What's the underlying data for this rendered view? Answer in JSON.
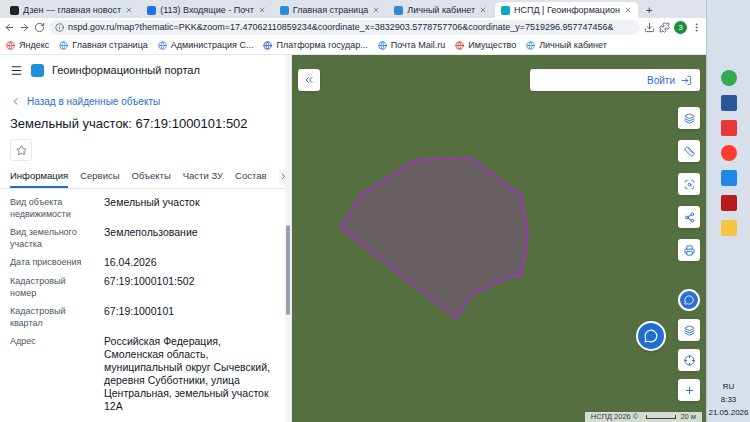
{
  "browser": {
    "tabs": [
      {
        "label": "Дзен — главная новост",
        "selected": false,
        "color": "#222222"
      },
      {
        "label": "(113) Входящие - Почт",
        "selected": false,
        "color": "#1a73e8"
      },
      {
        "label": "Главная страница",
        "selected": false,
        "color": "#2e8bd8"
      },
      {
        "label": "Личный кабинет",
        "selected": false,
        "color": "#2e8bd8"
      },
      {
        "label": "НСПД | Геоинформацион",
        "selected": true,
        "color": "#0ea5c6"
      }
    ],
    "new_tab": "+",
    "address": "nspd.gov.ru/map?thematic=PKK&zoom=17.47062110859234&coordinate_x=3832903.5778757706&coordinate_y=7519296.957747456&",
    "profile": "3",
    "bookmarks": [
      {
        "label": "Яндекс",
        "color": "#e53935"
      },
      {
        "label": "Главная страница",
        "color": "#2e8bd8"
      },
      {
        "label": "Администрация С...",
        "color": "#3b82f6"
      },
      {
        "label": "Платформа государ...",
        "color": "#1d4ed8"
      },
      {
        "label": "Почта Mail.ru",
        "color": "#1a73e8"
      },
      {
        "label": "Имущество",
        "color": "#d32f2f"
      },
      {
        "label": "Личный кабинет",
        "color": "#2e8bd8"
      }
    ]
  },
  "portal": {
    "title": "Геоинформационный портал",
    "back": "Назад в найденные объекты",
    "heading": "Земельный участок: 67:19:1000101:502",
    "favorite": false,
    "tabs": [
      {
        "label": "Информация",
        "selected": true
      },
      {
        "label": "Сервисы",
        "selected": false
      },
      {
        "label": "Объекты",
        "selected": false
      },
      {
        "label": "Части ЗУ",
        "selected": false
      },
      {
        "label": "Состав",
        "selected": false
      }
    ],
    "properties": [
      {
        "label": "Вид объекта недвижимости",
        "value": "Земельный участок"
      },
      {
        "label": "Вид земельного участка",
        "value": "Землепользование"
      },
      {
        "label": "Дата присвоения",
        "value": "16.04.2026"
      },
      {
        "label": "Кадастровый номер",
        "value": "67:19:1000101:502"
      },
      {
        "label": "Кадастровый квартал",
        "value": "67:19:1000101"
      },
      {
        "label": "Адрес",
        "value": "Российская Федерация, Смоленская область, муниципальный округ Сычевский, деревня Субботники, улица Центральная, земельный участок 12А"
      }
    ]
  },
  "map": {
    "login": "Войти",
    "attribution": "НСПД 2026 ©",
    "scale": "20 м"
  },
  "taskbar": {
    "apps": [
      {
        "color": "#34a853"
      },
      {
        "color": "#2b579a"
      },
      {
        "color": "#e53935"
      },
      {
        "color": "#ff3b30"
      },
      {
        "color": "#1e88e5"
      },
      {
        "color": "#b71c1c"
      },
      {
        "color": "#f5c542"
      }
    ],
    "language": "RU",
    "time": "8:33",
    "date": "21.05.2026"
  }
}
